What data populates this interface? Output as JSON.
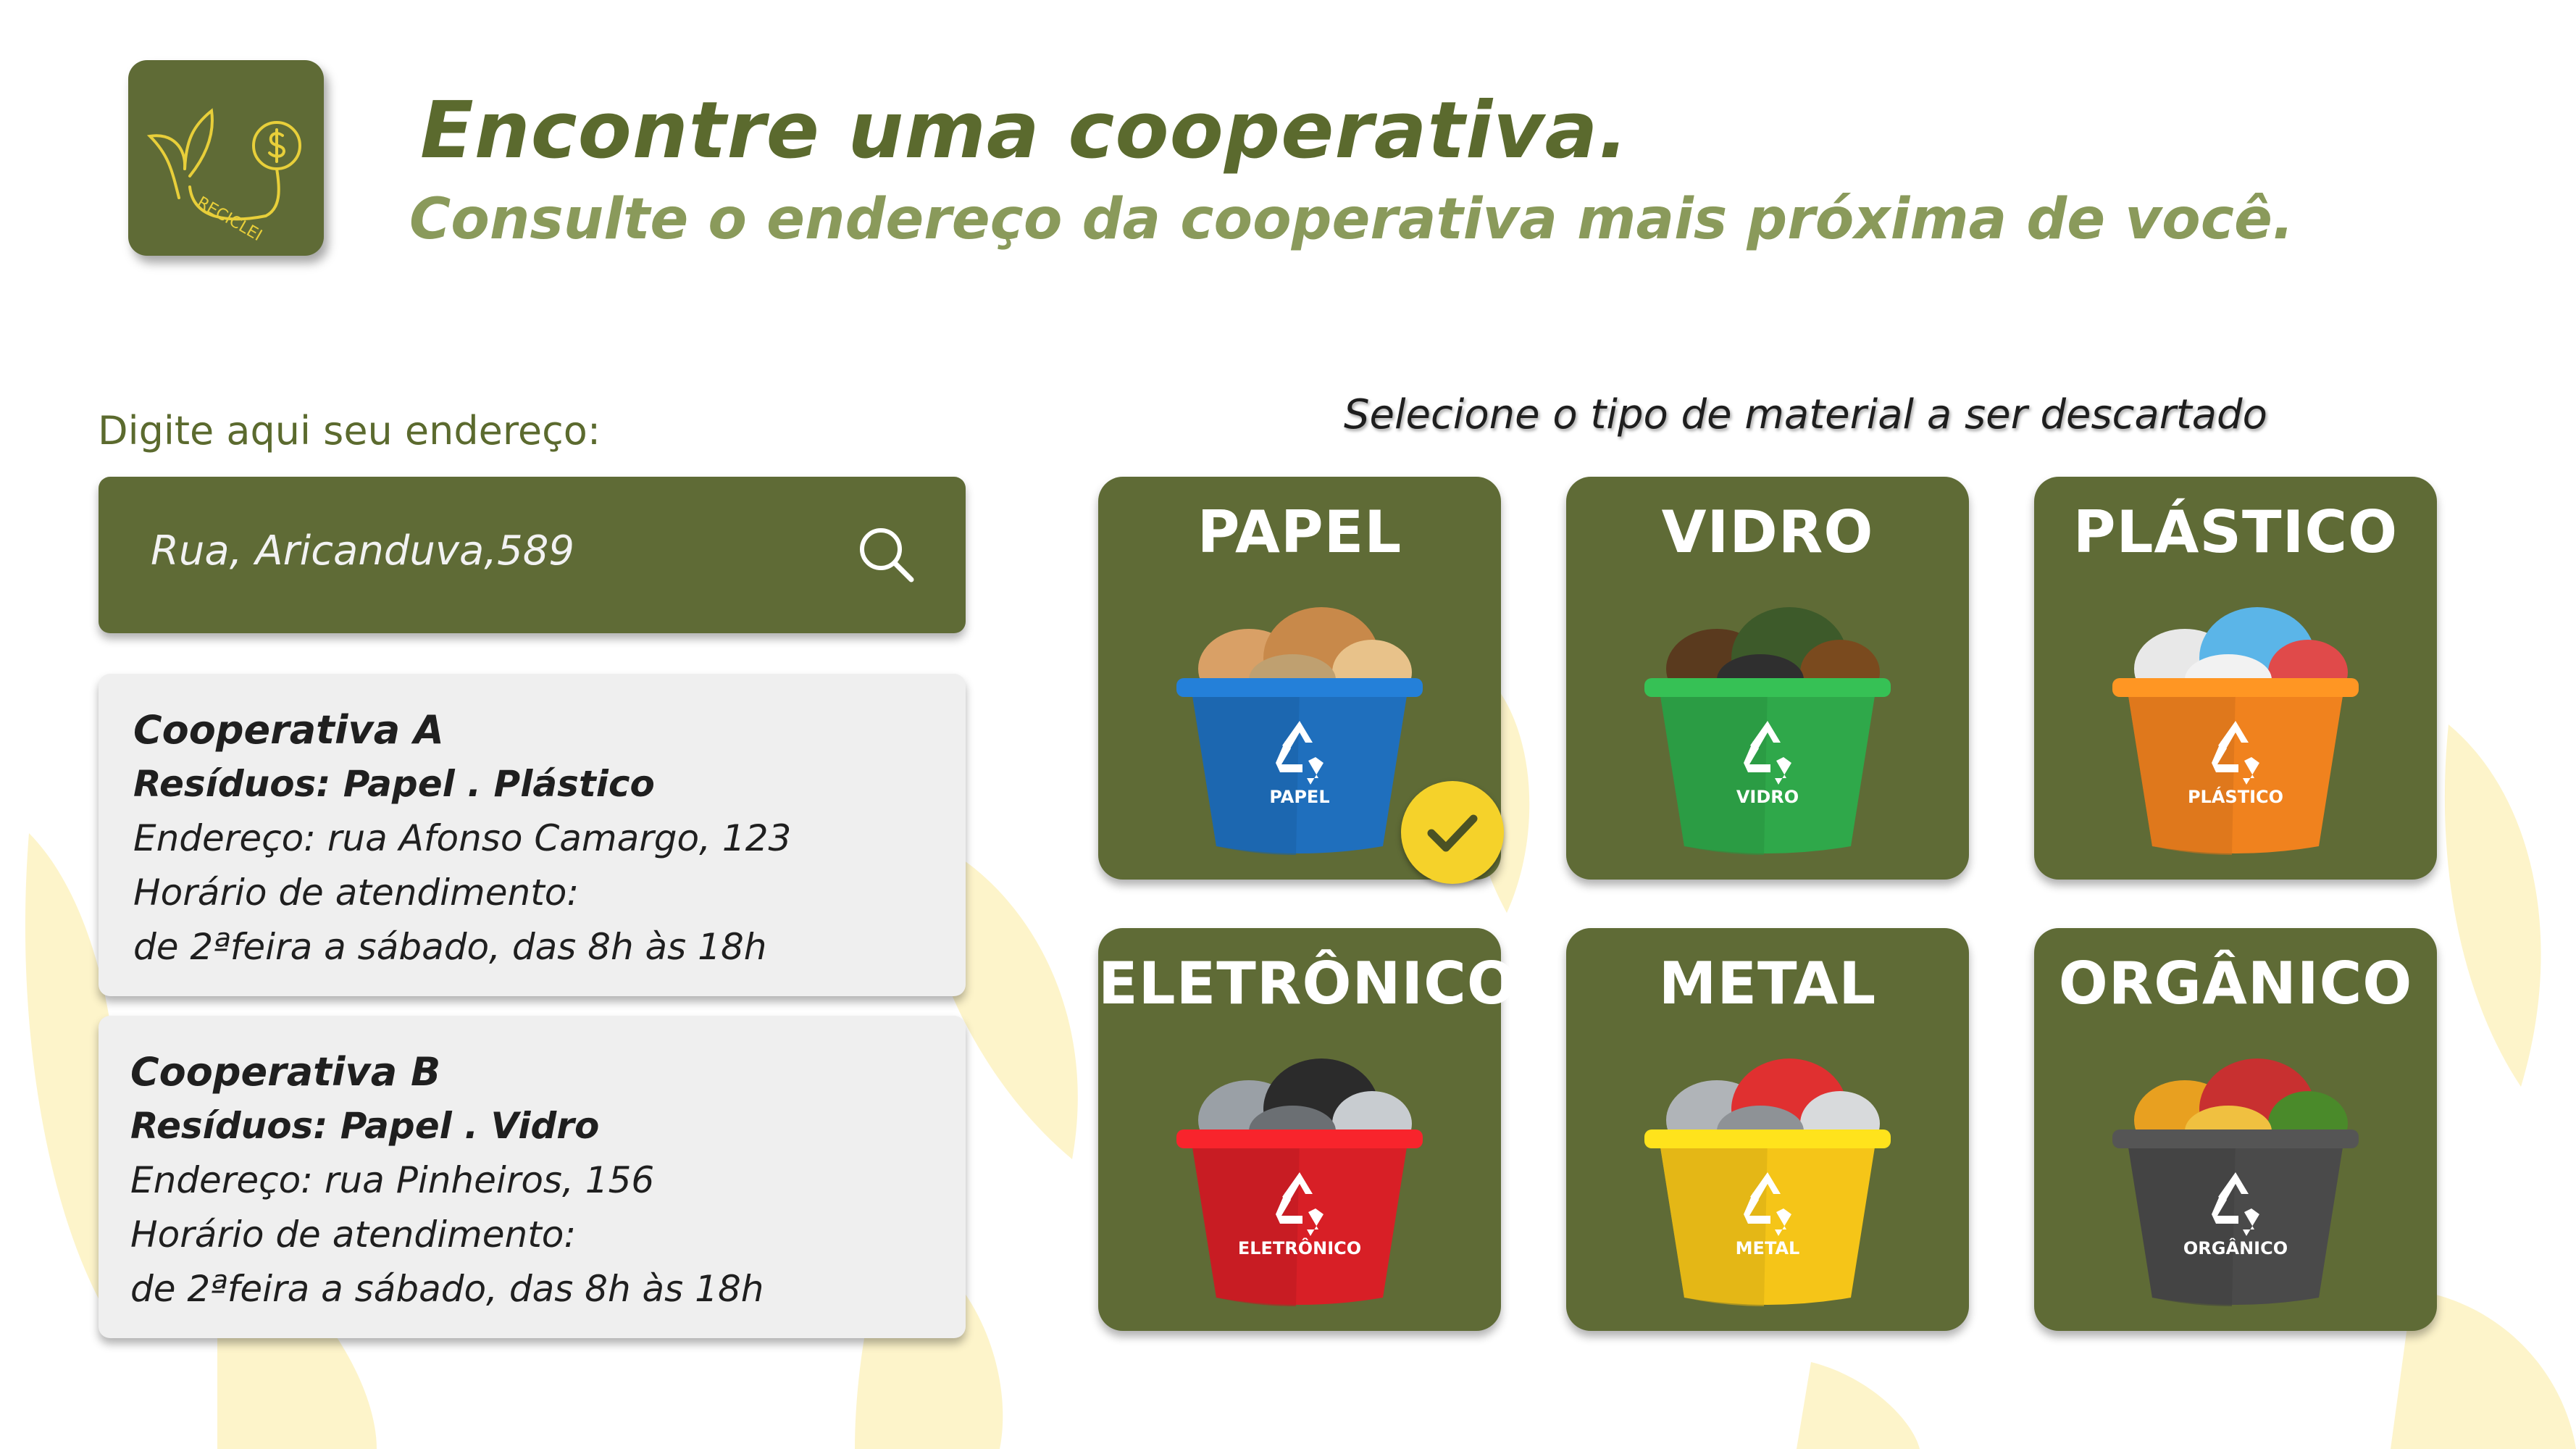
{
  "header": {
    "title": "Encontre uma cooperativa.",
    "subtitle": "Consulte o endereço da cooperativa mais próxima de você.",
    "logo_text": "RECICLEI"
  },
  "search": {
    "label": "Digite aqui seu endereço:",
    "value": "Rua, Aricanduva,589",
    "icon": "search-icon"
  },
  "cooperatives": [
    {
      "name": "Cooperativa A",
      "residues": "Resíduos: Papel . Plástico",
      "address": "Endereço: rua Afonso Camargo, 123",
      "hours_label": "Horário de atendimento:",
      "hours": "de 2ªfeira a sábado, das 8h às 18h"
    },
    {
      "name": "Cooperativa B",
      "residues": "Resíduos: Papel . Vidro",
      "address": "Endereço: rua Pinheiros, 156",
      "hours_label": "Horário de atendimento:",
      "hours": "de 2ªfeira a sábado, das 8h às 18h"
    }
  ],
  "materials": {
    "label": "Selecione o tipo de material a ser descartado",
    "items": [
      {
        "name": "PAPEL",
        "bin_label": "PAPEL",
        "color": "#1f6fbd",
        "selected": true
      },
      {
        "name": "VIDRO",
        "bin_label": "VIDRO",
        "color": "#2fa84a",
        "selected": false
      },
      {
        "name": "PLÁSTICO",
        "bin_label": "PLÁSTICO",
        "color": "#f0821e",
        "selected": false
      },
      {
        "name": "ELETRÔNICO",
        "bin_label": "ELETRÔNICO",
        "color": "#d81f26",
        "selected": false
      },
      {
        "name": "METAL",
        "bin_label": "METAL",
        "color": "#f5c518",
        "selected": false
      },
      {
        "name": "ORGÂNICO",
        "bin_label": "ORGÂNICO",
        "color": "#4a4a4a",
        "selected": false
      }
    ]
  },
  "colors": {
    "brand_green": "#5f6b36",
    "title_green": "#5b6a2e",
    "subtitle_green": "#8a9a5b",
    "card_gray": "#efefef",
    "check_yellow": "#f5d22a",
    "leaf_yellow": "#fdf3c4"
  }
}
